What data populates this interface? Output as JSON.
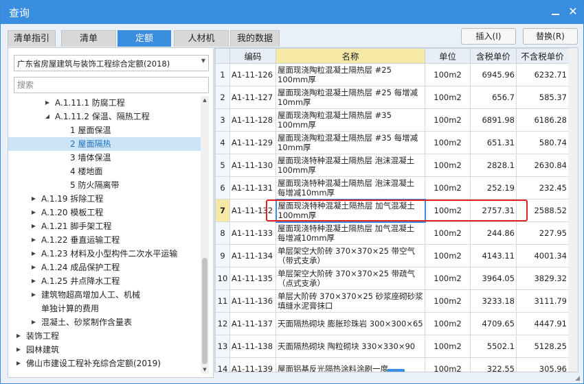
{
  "window": {
    "title": "查询"
  },
  "tabs": [
    {
      "label": "清单指引",
      "active": false
    },
    {
      "label": "清单",
      "active": false
    },
    {
      "label": "定额",
      "active": true
    },
    {
      "label": "人材机",
      "active": false
    },
    {
      "label": "我的数据",
      "active": false
    }
  ],
  "actions": {
    "insert": "插入(I)",
    "replace": "替换(R)"
  },
  "library": {
    "selected": "广东省房屋建筑与装饰工程综合定额(2018)"
  },
  "search": {
    "placeholder": "搜索"
  },
  "tree": [
    {
      "label": "A.1.11.1 防腐工程",
      "arrow": "▶",
      "level": 3,
      "selected": false
    },
    {
      "label": "A.1.11.2 保温、隔热工程",
      "arrow": "◢",
      "level": 3,
      "selected": false
    },
    {
      "label": "1 屋面保温",
      "arrow": "",
      "level": 4,
      "selected": false
    },
    {
      "label": "2 屋面隔热",
      "arrow": "",
      "level": 4,
      "selected": true
    },
    {
      "label": "3 墙体保温",
      "arrow": "",
      "level": 4,
      "selected": false
    },
    {
      "label": "4 楼地面",
      "arrow": "",
      "level": 4,
      "selected": false
    },
    {
      "label": "5 防火隔离带",
      "arrow": "",
      "level": 4,
      "selected": false
    },
    {
      "label": "A.1.19 拆除工程",
      "arrow": "▶",
      "level": 2,
      "selected": false
    },
    {
      "label": "A.1.20 模板工程",
      "arrow": "▶",
      "level": 2,
      "selected": false
    },
    {
      "label": "A.1.21 脚手架工程",
      "arrow": "▶",
      "level": 2,
      "selected": false
    },
    {
      "label": "A.1.22 垂直运输工程",
      "arrow": "▶",
      "level": 2,
      "selected": false
    },
    {
      "label": "A.1.23 材料及小型构件二次水平运输",
      "arrow": "▶",
      "level": 2,
      "selected": false
    },
    {
      "label": "A.1.24 成品保护工程",
      "arrow": "▶",
      "level": 2,
      "selected": false
    },
    {
      "label": "A.1.25 井点降水工程",
      "arrow": "▶",
      "level": 2,
      "selected": false
    },
    {
      "label": "建筑物超高增加人工、机械",
      "arrow": "▶",
      "level": 2,
      "selected": false
    },
    {
      "label": "单独计算的费用",
      "arrow": "",
      "level": 2,
      "selected": false
    },
    {
      "label": "混凝土、砂浆制作含量表",
      "arrow": "▶",
      "level": 2,
      "selected": false
    },
    {
      "label": "装饰工程",
      "arrow": "▶",
      "level": 1,
      "selected": false
    },
    {
      "label": "园林建筑",
      "arrow": "▶",
      "level": 1,
      "selected": false
    },
    {
      "label": "佛山市建设工程补充综合定额(2019)",
      "arrow": "▶",
      "level": 1,
      "selected": false
    }
  ],
  "table": {
    "headers": [
      "",
      "编码",
      "名称",
      "单位",
      "含税单价",
      "不含税单价"
    ],
    "rows": [
      {
        "idx": "1",
        "code": "A1-11-126",
        "name": "屋面现浇陶粒混凝土隔热层 #25 100mm厚",
        "unit": "100m2",
        "tax": "6945.96",
        "notax": "6232.71"
      },
      {
        "idx": "2",
        "code": "A1-11-127",
        "name": "屋面现浇陶粒混凝土隔热层 #25 每增减10mm厚",
        "unit": "100m2",
        "tax": "656.7",
        "notax": "585.37"
      },
      {
        "idx": "3",
        "code": "A1-11-128",
        "name": "屋面现浇陶粒混凝土隔热层 #35 100mm厚",
        "unit": "100m2",
        "tax": "6891.98",
        "notax": "6186.28"
      },
      {
        "idx": "4",
        "code": "A1-11-129",
        "name": "屋面现浇陶粒混凝土隔热层 #35 每增减10mm厚",
        "unit": "100m2",
        "tax": "651.31",
        "notax": "580.74"
      },
      {
        "idx": "5",
        "code": "A1-11-130",
        "name": "屋面现浇特种混凝土隔热层 泡沫混凝土 100mm厚",
        "unit": "100m2",
        "tax": "2828.1",
        "notax": "2630.84"
      },
      {
        "idx": "6",
        "code": "A1-11-131",
        "name": "屋面现浇特种混凝土隔热层 泡沫混凝土 每增减10mm厚",
        "unit": "100m2",
        "tax": "252.19",
        "notax": "232.45"
      },
      {
        "idx": "7",
        "code": "A1-11-132",
        "name": "屋面现浇特种混凝土隔热层 加气混凝土 100mm厚",
        "unit": "100m2",
        "tax": "2757.31",
        "notax": "2588.52",
        "selected": true
      },
      {
        "idx": "8",
        "code": "A1-11-133",
        "name": "屋面现浇特种混凝土隔热层 加气混凝土 每增减10mm厚",
        "unit": "100m2",
        "tax": "244.86",
        "notax": "227.95"
      },
      {
        "idx": "9",
        "code": "A1-11-134",
        "name": "单层架空大阶砖 370×370×25 带空气（带式支承）",
        "unit": "100m2",
        "tax": "4143.11",
        "notax": "4001.34"
      },
      {
        "idx": "10",
        "code": "A1-11-135",
        "name": "单层架空大阶砖 370×370×25 带疏气（点式支承）",
        "unit": "100m2",
        "tax": "3964.05",
        "notax": "3829.32"
      },
      {
        "idx": "11",
        "code": "A1-11-136",
        "name": "单层大阶砖 370×370×25 砂浆座砌砂浆填缝水泥膏抹口",
        "unit": "100m2",
        "tax": "3233.18",
        "notax": "3111.79"
      },
      {
        "idx": "12",
        "code": "A1-11-137",
        "name": "天面隔热砌块 膨胀珍珠岩 300×300×65",
        "unit": "100m2",
        "tax": "4709.65",
        "notax": "4447.91"
      },
      {
        "idx": "13",
        "code": "A1-11-138",
        "name": "天面隔热砌块 陶粒砌块 330×330×90",
        "unit": "100m2",
        "tax": "5502.1",
        "notax": "5128.25"
      },
      {
        "idx": "14",
        "code": "A1-11-139",
        "name": "屋面铝基反光隔热涂料涂刷一度",
        "unit": "100m2",
        "tax": "322.55",
        "notax": "305.96"
      }
    ]
  },
  "colors": {
    "accent": "#3a8ee0",
    "highlight": "#e02020",
    "header_name": "#f6e9a6"
  }
}
